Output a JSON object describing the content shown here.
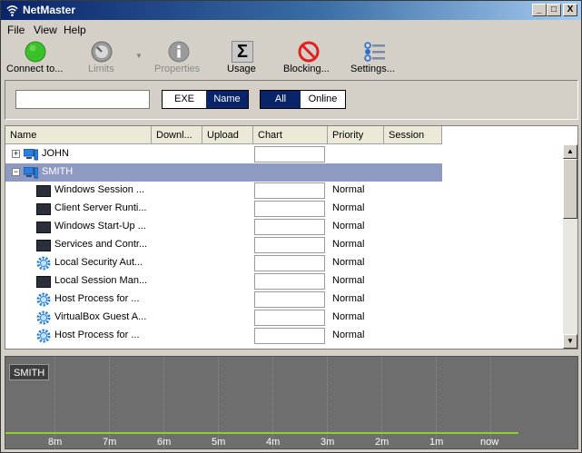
{
  "window": {
    "title": "NetMaster",
    "min_label": "_",
    "max_label": "□",
    "close_label": "X"
  },
  "menu": {
    "items": [
      "File",
      "View",
      "Help"
    ]
  },
  "toolbar": {
    "connect": "Connect to...",
    "limits": "Limits",
    "properties": "Properties",
    "usage": "Usage",
    "blocking": "Blocking...",
    "settings": "Settings..."
  },
  "filter": {
    "search_value": "",
    "exe_label": "EXE",
    "name_label": "Name",
    "all_label": "All",
    "online_label": "Online",
    "active_mode": "Name",
    "active_scope": "All"
  },
  "table": {
    "columns": [
      "Name",
      "Downl...",
      "Upload",
      "Chart",
      "Priority",
      "Session"
    ],
    "groups": [
      {
        "name": "JOHN",
        "expander": "+",
        "expanded": false
      },
      {
        "name": "SMITH",
        "expander": "−",
        "expanded": true,
        "selected": true
      }
    ],
    "rows": [
      {
        "name": "Windows Session ...",
        "icon": "window-icon",
        "priority": "Normal"
      },
      {
        "name": "Client Server Runti...",
        "icon": "window-icon",
        "priority": "Normal"
      },
      {
        "name": "Windows Start-Up ...",
        "icon": "window-icon",
        "priority": "Normal"
      },
      {
        "name": "Services and Contr...",
        "icon": "window-icon",
        "priority": "Normal"
      },
      {
        "name": "Local Security Aut...",
        "icon": "gear-icon",
        "priority": "Normal"
      },
      {
        "name": "Local Session Man...",
        "icon": "window-icon",
        "priority": "Normal"
      },
      {
        "name": "Host Process for ...",
        "icon": "gear-icon",
        "priority": "Normal"
      },
      {
        "name": "VirtualBox Guest A...",
        "icon": "gear-icon",
        "priority": "Normal"
      },
      {
        "name": "Host Process for ...",
        "icon": "gear-icon",
        "priority": "Normal"
      }
    ]
  },
  "graph": {
    "legend": "SMITH",
    "ticks": [
      "8m",
      "7m",
      "6m",
      "5m",
      "4m",
      "3m",
      "2m",
      "1m",
      "now"
    ],
    "colors": {
      "background": "#6e6e6e",
      "line": "#8fcf2a"
    }
  }
}
